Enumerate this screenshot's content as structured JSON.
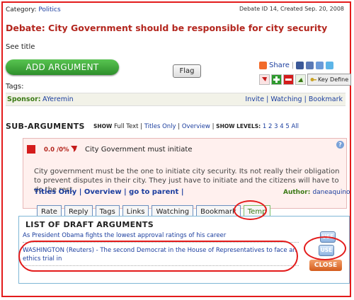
{
  "header": {
    "category_label": "Category:",
    "category_value": "Politics",
    "meta": "Debate ID 14, Created Sep. 20, 2008",
    "title": "Debate: City Government should be responsible for city security",
    "see_title": "See title"
  },
  "actions": {
    "add_argument": "ADD ARGUMENT",
    "flag": "Flag",
    "share": "Share",
    "key_define": "Key Define",
    "tags_label": "Tags:"
  },
  "sponsor": {
    "label": "Sponsor:",
    "name": "AYeremin",
    "invite": "Invite",
    "watching": "Watching",
    "bookmark": "Bookmark",
    "sep": "|"
  },
  "subargs": {
    "heading": "SUB-ARGUMENTS",
    "show_label": "SHOW",
    "full_text": "Full Text",
    "titles_only": "Titles Only",
    "overview": "Overview",
    "levels_label": "SHOW LEVELS:",
    "levels": [
      "1",
      "2",
      "3",
      "4",
      "5",
      "All"
    ],
    "sep": "|"
  },
  "argument": {
    "score": "0.0 /0%",
    "title": "City Government must initiate",
    "body": "City government must be the one to initiate city security. Its not really their obligation to prevent disputes in their city. They just have to initiate and the citizens will have to do the rest.",
    "links": "Titles Only | Overview | go to parent |",
    "author_label": "Author:",
    "author_name": "daneaquino",
    "tabs": [
      "Rate",
      "Reply",
      "Tags",
      "Links",
      "Watching",
      "Bookmark",
      "Temp"
    ]
  },
  "drafts": {
    "heading": "LIST OF DRAFT ARGUMENTS",
    "items": [
      "As President Obama fights the lowest approval ratings of his career",
      "WASHINGTON (Reuters) - The second Democrat in the House of Representatives to face an ethics trial in"
    ],
    "use_label": "USE",
    "close_label": "CLOSE"
  },
  "colors": {
    "accent_red": "#b3261e",
    "link_blue": "#1a3d9e",
    "green": "#3b7a16",
    "annotation_red": "#e31b1b"
  }
}
